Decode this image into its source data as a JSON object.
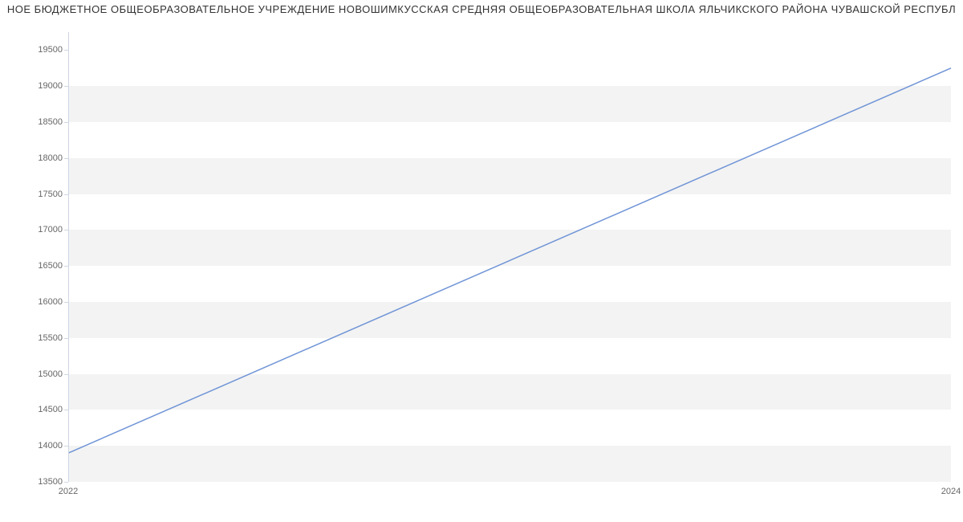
{
  "chart_data": {
    "type": "line",
    "title": "НОЕ БЮДЖЕТНОЕ ОБЩЕОБРАЗОВАТЕЛЬНОЕ УЧРЕЖДЕНИЕ НОВОШИМКУССКАЯ СРЕДНЯЯ ОБЩЕОБРАЗОВАТЕЛЬНАЯ ШКОЛА ЯЛЬЧИКСКОГО РАЙОНА ЧУВАШСКОЙ РЕСПУБЛ",
    "x": [
      2022,
      2024
    ],
    "values": [
      13900,
      19250
    ],
    "xticks": [
      2022,
      2024
    ],
    "yticks": [
      13500,
      14000,
      14500,
      15000,
      15500,
      16000,
      16500,
      17000,
      17500,
      18000,
      18500,
      19000,
      19500
    ],
    "ylim": [
      13500,
      19750
    ],
    "xlim": [
      2022,
      2024
    ],
    "line_color": "#6f94d6"
  }
}
